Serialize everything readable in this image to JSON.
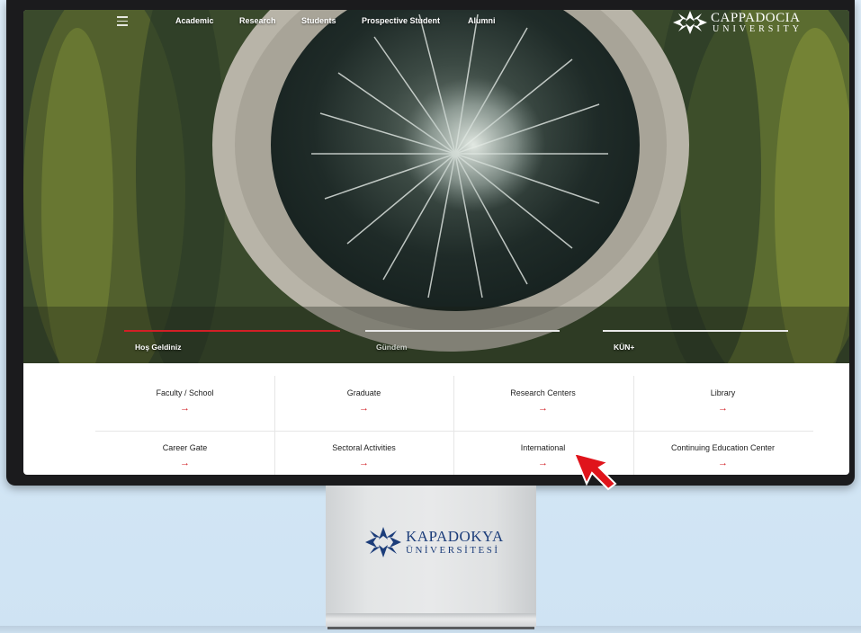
{
  "nav": {
    "items": [
      "Academic",
      "Research",
      "Students",
      "Prospective Student",
      "Alumni"
    ]
  },
  "brand": {
    "name": "CAPPADOCIA",
    "sub": "UNIVERSITY"
  },
  "hero_tabs": [
    {
      "label": "Hoş Geldiniz",
      "active": true
    },
    {
      "label": "Gündem",
      "active": false
    },
    {
      "label": "KÜN+",
      "active": false
    }
  ],
  "quick_links": [
    {
      "label": "Faculty / School",
      "arrow": "→"
    },
    {
      "label": "Graduate",
      "arrow": "→"
    },
    {
      "label": "Research Centers",
      "arrow": "→"
    },
    {
      "label": "Library",
      "arrow": "→"
    },
    {
      "label": "Career Gate",
      "arrow": "→"
    },
    {
      "label": "Sectoral Activities",
      "arrow": "→"
    },
    {
      "label": "International",
      "arrow": "→"
    },
    {
      "label": "Continuing Education Center",
      "arrow": "→"
    }
  ],
  "stand_brand": {
    "name": "KAPADOKYA",
    "sub": "ÜNİVERSİTESİ"
  },
  "colors": {
    "accent": "#d21f26",
    "stand_brand": "#1c3d7a"
  }
}
